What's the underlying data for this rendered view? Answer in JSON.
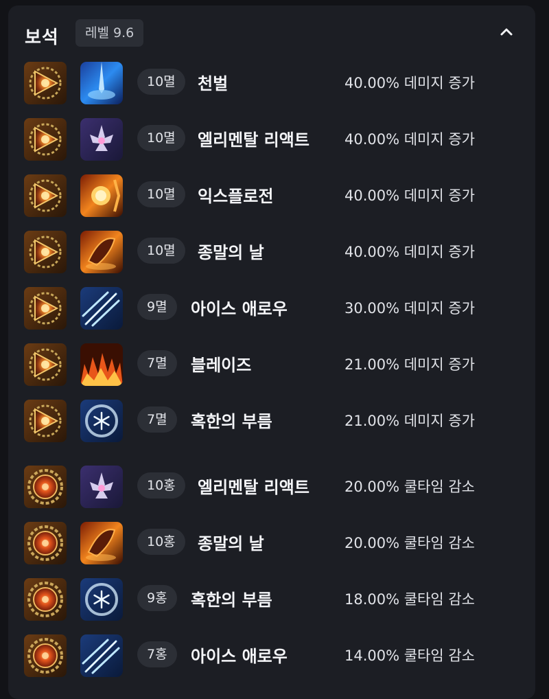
{
  "header": {
    "title": "보석",
    "level_badge": "레벨 9.6"
  },
  "colors": {
    "panel_bg": "#1c1e24",
    "page_bg": "#121317",
    "badge_bg": "#2c2f36",
    "gem_annihilation": "#c8602a",
    "gem_crimson": "#d4471f"
  },
  "gems": [
    {
      "gem_type": "annihilation-gem",
      "skill_icon": "judgment-skill-icon",
      "tag": "10멸",
      "skill": "천벌",
      "effect": "40.00% 데미지 증가"
    },
    {
      "gem_type": "annihilation-gem",
      "skill_icon": "elemental-reactor-skill-icon",
      "tag": "10멸",
      "skill": "엘리멘탈 리액트",
      "effect": "40.00% 데미지 증가"
    },
    {
      "gem_type": "annihilation-gem",
      "skill_icon": "explosion-skill-icon",
      "tag": "10멸",
      "skill": "익스플로전",
      "effect": "40.00% 데미지 증가"
    },
    {
      "gem_type": "annihilation-gem",
      "skill_icon": "doomsday-skill-icon",
      "tag": "10멸",
      "skill": "종말의 날",
      "effect": "40.00% 데미지 증가"
    },
    {
      "gem_type": "annihilation-gem",
      "skill_icon": "ice-arrow-skill-icon",
      "tag": "9멸",
      "skill": "아이스 애로우",
      "effect": "30.00% 데미지 증가"
    },
    {
      "gem_type": "annihilation-gem",
      "skill_icon": "blaze-skill-icon",
      "tag": "7멸",
      "skill": "블레이즈",
      "effect": "21.00% 데미지 증가"
    },
    {
      "gem_type": "annihilation-gem",
      "skill_icon": "frost-call-skill-icon",
      "tag": "7멸",
      "skill": "혹한의 부름",
      "effect": "21.00% 데미지 증가"
    },
    {
      "gem_type": "crimson-flame-gem",
      "skill_icon": "elemental-reactor-skill-icon",
      "tag": "10홍",
      "skill": "엘리멘탈 리액트",
      "effect": "20.00% 쿨타임 감소"
    },
    {
      "gem_type": "crimson-flame-gem",
      "skill_icon": "doomsday-skill-icon",
      "tag": "10홍",
      "skill": "종말의 날",
      "effect": "20.00% 쿨타임 감소"
    },
    {
      "gem_type": "crimson-flame-gem",
      "skill_icon": "frost-call-skill-icon",
      "tag": "9홍",
      "skill": "혹한의 부름",
      "effect": "18.00% 쿨타임 감소"
    },
    {
      "gem_type": "crimson-flame-gem",
      "skill_icon": "ice-arrow-skill-icon",
      "tag": "7홍",
      "skill": "아이스 애로우",
      "effect": "14.00% 쿨타임 감소"
    }
  ]
}
